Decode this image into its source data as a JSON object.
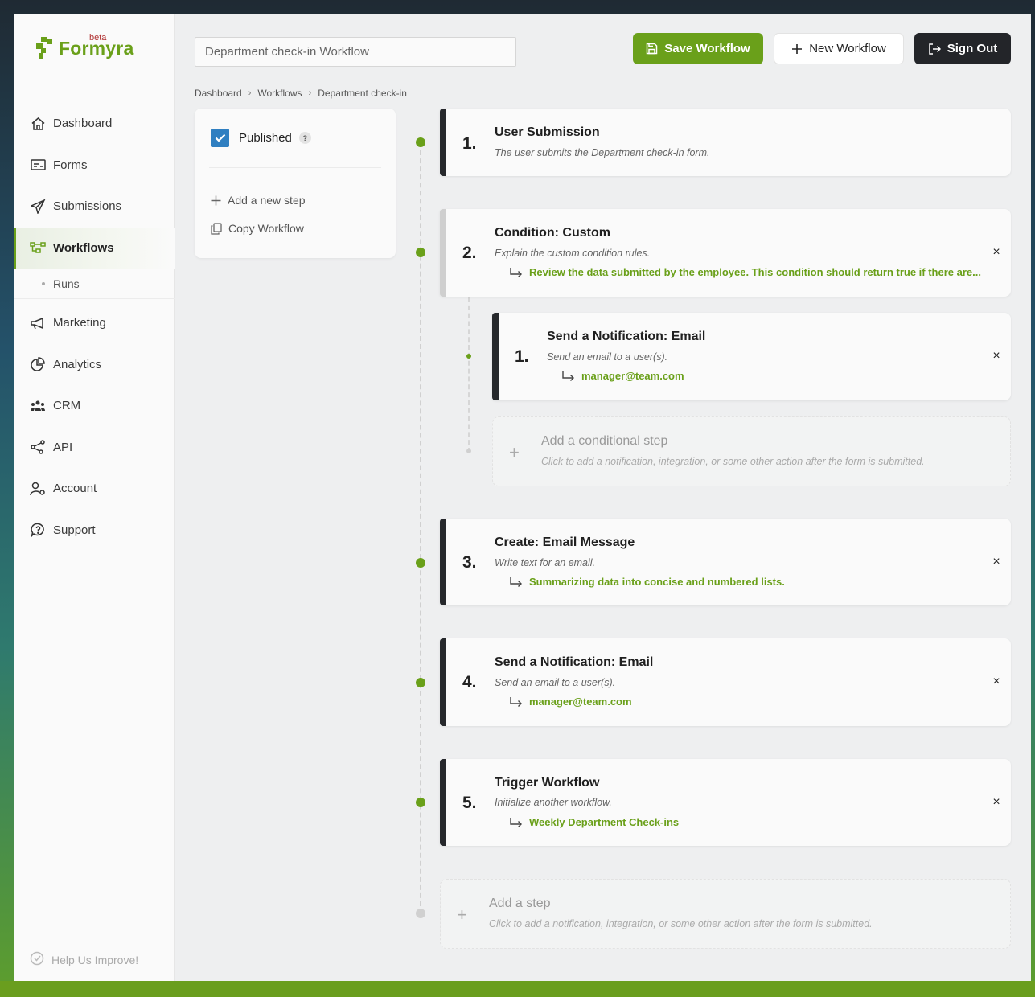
{
  "app": {
    "brand": "Formyra",
    "brand_tag": "beta",
    "brand_color": "#6aa01a"
  },
  "sidebar": {
    "items": [
      {
        "label": "Dashboard",
        "icon": "home-icon"
      },
      {
        "label": "Forms",
        "icon": "form-icon"
      },
      {
        "label": "Submissions",
        "icon": "paper-plane-icon"
      },
      {
        "label": "Workflows",
        "icon": "workflow-icon",
        "active": true
      },
      {
        "label": "Marketing",
        "icon": "megaphone-icon"
      },
      {
        "label": "Analytics",
        "icon": "pie-chart-icon"
      },
      {
        "label": "CRM",
        "icon": "people-icon"
      },
      {
        "label": "API",
        "icon": "share-nodes-icon"
      },
      {
        "label": "Account",
        "icon": "user-gear-icon"
      },
      {
        "label": "Support",
        "icon": "question-bubble-icon"
      }
    ],
    "sub_items": [
      {
        "label": "Runs"
      }
    ],
    "help_label": "Help Us Improve!"
  },
  "header": {
    "workflow_title_value": "Department check-in Workflow",
    "save_label": "Save Workflow",
    "new_label": "New Workflow",
    "signout_label": "Sign Out"
  },
  "breadcrumb": [
    "Dashboard",
    "Workflows",
    "Department check-in"
  ],
  "panel": {
    "published_label": "Published",
    "published_checked": true,
    "help_mark": "?",
    "add_step_label": "Add a new step",
    "copy_label": "Copy Workflow"
  },
  "steps": [
    {
      "num": "1.",
      "title": "User Submission",
      "desc": "The user submits the Department check-in form."
    },
    {
      "num": "2.",
      "title": "Condition: Custom",
      "desc": "Explain the custom condition rules.",
      "value": "Review the data submitted by the employee. This condition should return true if there are..."
    },
    {
      "num": "3.",
      "title": "Create: Email Message",
      "desc": "Write text for an email.",
      "value": "Summarizing data into concise and numbered lists."
    },
    {
      "num": "4.",
      "title": "Send a Notification: Email",
      "desc": "Send an email to a user(s).",
      "value": "manager@team.com"
    },
    {
      "num": "5.",
      "title": "Trigger Workflow",
      "desc": "Initialize another workflow.",
      "value": "Weekly Department Check-ins"
    }
  ],
  "sub_step": {
    "num": "1.",
    "title": "Send a Notification: Email",
    "desc": "Send an email to a user(s).",
    "value": "manager@team.com"
  },
  "add_conditional": {
    "title": "Add a conditional step",
    "desc": "Click to add a notification, integration, or some other action after the form is submitted."
  },
  "add_step": {
    "title": "Add a step",
    "desc": "Click to add a notification, integration, or some other action after the form is submitted."
  },
  "close_glyph": "×",
  "plus_glyph": "+"
}
